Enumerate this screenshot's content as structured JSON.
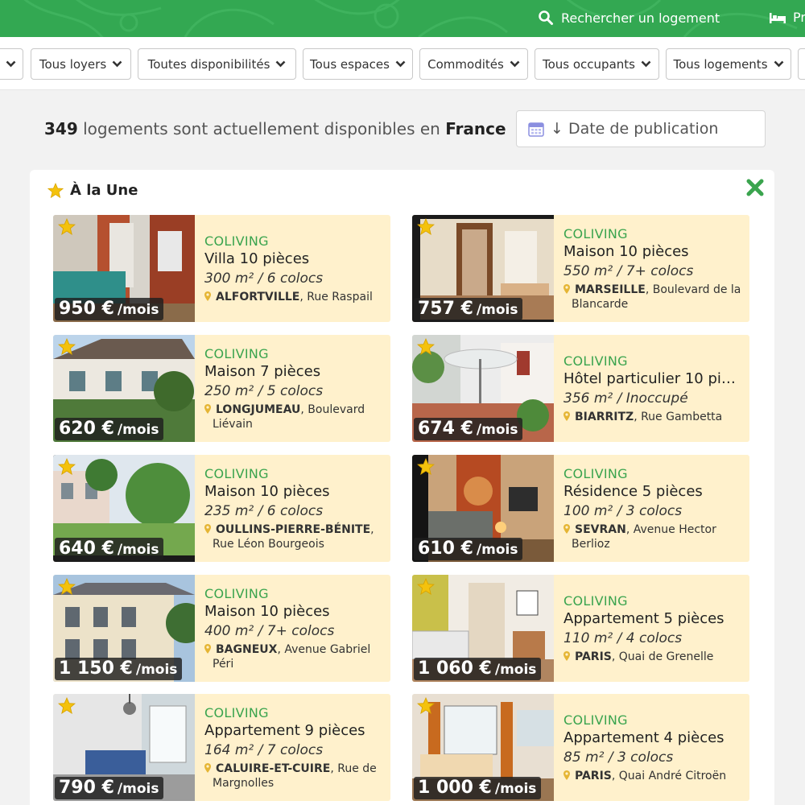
{
  "topnav": {
    "search_label": "Rechercher un logement",
    "second_label": "Pr"
  },
  "filters": [
    {
      "label": ""
    },
    {
      "label": "Tous loyers"
    },
    {
      "label": "Toutes disponibilités"
    },
    {
      "label": "Tous espaces"
    },
    {
      "label": "Commodités"
    },
    {
      "label": "Tous occupants"
    },
    {
      "label": "Tous logements"
    },
    {
      "label": ""
    }
  ],
  "results": {
    "count": "349",
    "text": "logements sont actuellement disponibles en",
    "country": "France"
  },
  "sort": {
    "label": "↓ Date de publication"
  },
  "featured": {
    "title": "À la Une",
    "listings": [
      {
        "price": "950 €",
        "per": "/mois",
        "type": "COLIVING",
        "title": "Villa 10 pièces",
        "sub": "300 m² / 6 colocs",
        "city": "ALFORTVILLE",
        "street": ", Rue Raspail"
      },
      {
        "price": "757 €",
        "per": "/mois",
        "type": "COLIVING",
        "title": "Maison 10 pièces",
        "sub": "550 m² / 7+ colocs",
        "city": "MARSEILLE",
        "street": ", Boulevard de la Blancarde"
      },
      {
        "price": "620 €",
        "per": "/mois",
        "type": "COLIVING",
        "title": "Maison 7 pièces",
        "sub": "250 m² / 5 colocs",
        "city": "LONGJUMEAU",
        "street": ", Boulevard Liévain"
      },
      {
        "price": "674 €",
        "per": "/mois",
        "type": "COLIVING",
        "title": "Hôtel particulier 10 pièc…",
        "sub": "356 m² / Inoccupé",
        "city": "BIARRITZ",
        "street": ", Rue Gambetta"
      },
      {
        "price": "640 €",
        "per": "/mois",
        "type": "COLIVING",
        "title": "Maison 10 pièces",
        "sub": "235 m² / 6 colocs",
        "city": "OULLINS-PIERRE-BÉNITE",
        "street": ", Rue Léon Bourgeois"
      },
      {
        "price": "610 €",
        "per": "/mois",
        "type": "COLIVING",
        "title": "Résidence 5 pièces",
        "sub": "100 m² / 3 colocs",
        "city": "SEVRAN",
        "street": ", Avenue Hector Berlioz"
      },
      {
        "price": "1 150 €",
        "per": "/mois",
        "type": "COLIVING",
        "title": "Maison 10 pièces",
        "sub": "400 m² / 7+ colocs",
        "city": "BAGNEUX",
        "street": ", Avenue Gabriel Péri"
      },
      {
        "price": "1 060 €",
        "per": "/mois",
        "type": "COLIVING",
        "title": "Appartement 5 pièces",
        "sub": "110 m² / 4 colocs",
        "city": "PARIS",
        "street": ", Quai de Grenelle"
      },
      {
        "price": "790 €",
        "per": "/mois",
        "type": "COLIVING",
        "title": "Appartement 9 pièces",
        "sub": "164 m² / 7 colocs",
        "city": "CALUIRE-ET-CUIRE",
        "street": ", Rue de Margnolles"
      },
      {
        "price": "1 000 €",
        "per": "/mois",
        "type": "COLIVING",
        "title": "Appartement 4 pièces",
        "sub": "85 m² / 3 colocs",
        "city": "PARIS",
        "street": ", Quai André Citroën"
      }
    ]
  },
  "colors": {
    "brand_green": "#33a852",
    "card_bg": "#fff1cc",
    "type_green": "#3aa44e",
    "star_gold": "#f4c20d",
    "pin_gold": "#e5b534"
  }
}
